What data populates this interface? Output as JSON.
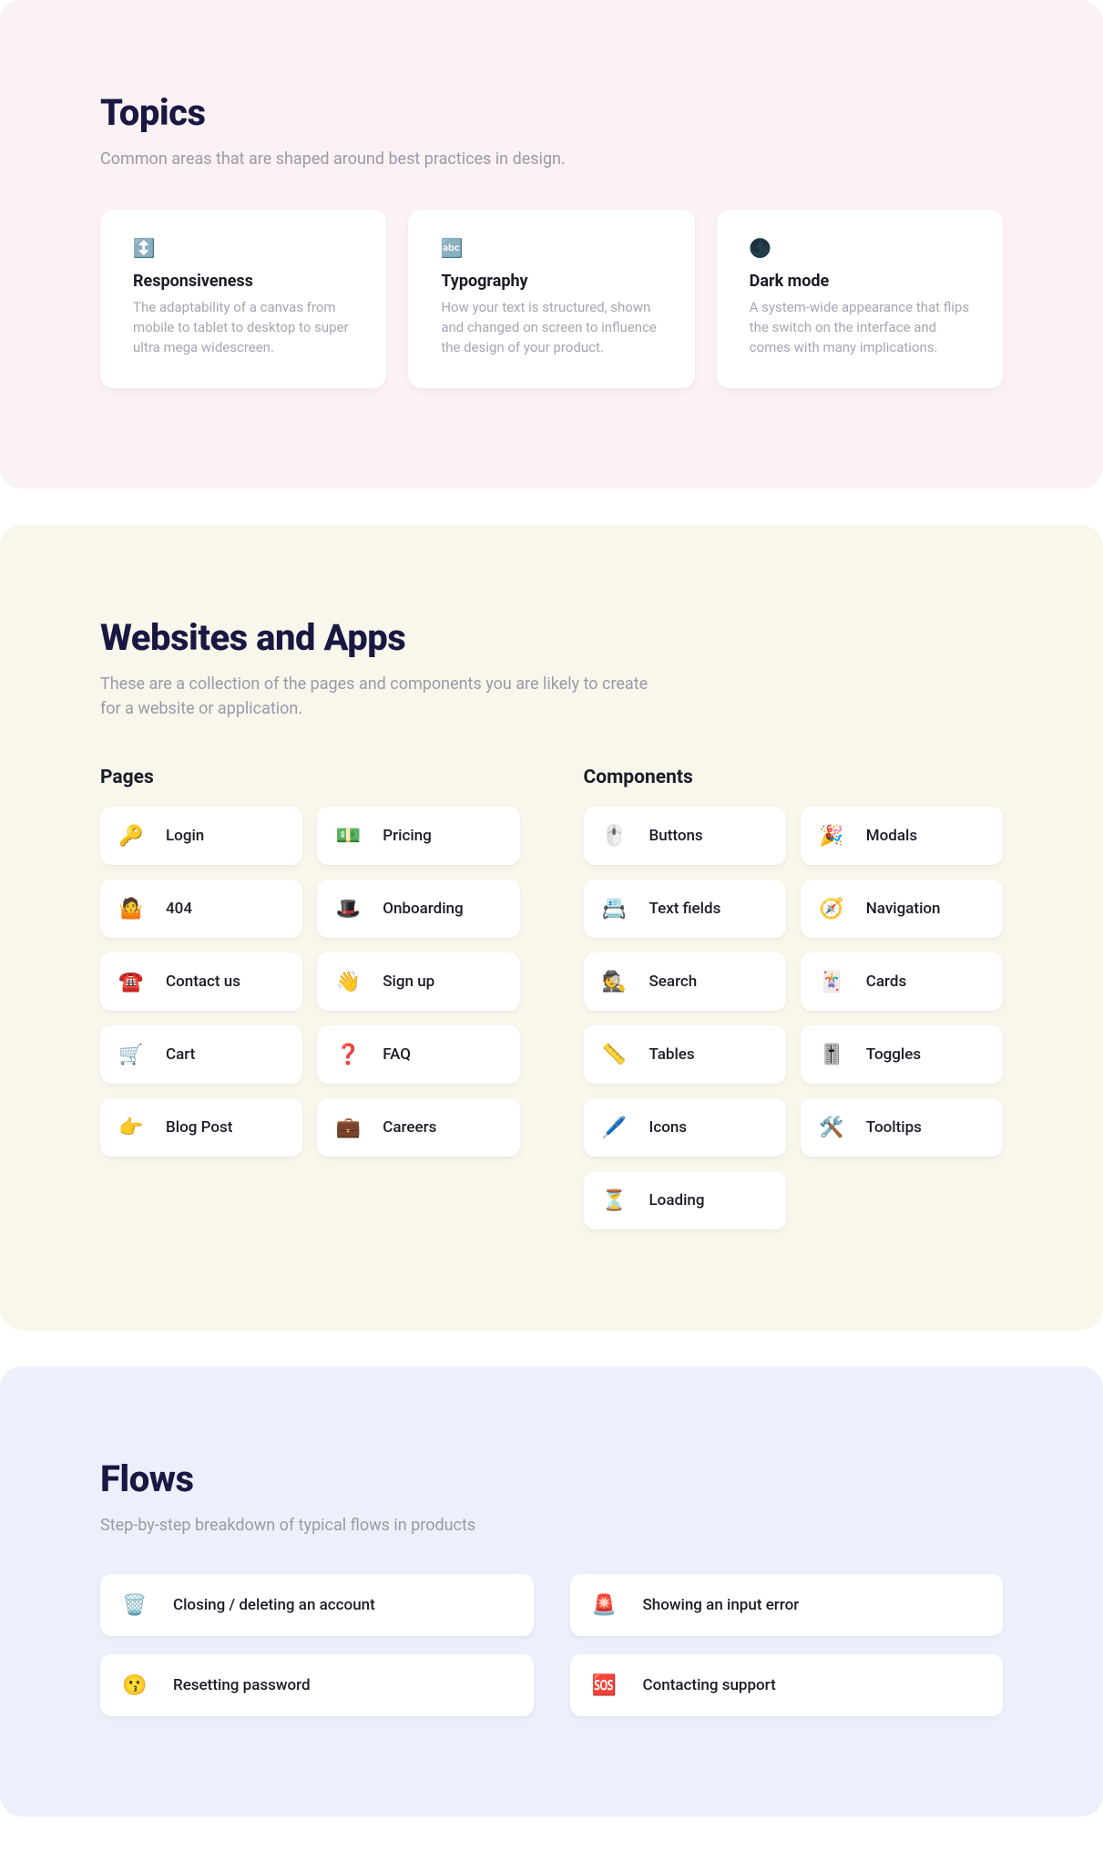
{
  "topics": {
    "heading": "Topics",
    "sub": "Common areas that are shaped around best practices in design.",
    "cards": [
      {
        "icon": "↕️",
        "icon_name": "responsive-icon",
        "title": "Responsiveness",
        "desc": "The adaptability of a canvas from mobile to tablet to desktop to super ultra mega widescreen."
      },
      {
        "icon": "🔤",
        "icon_name": "typography-icon",
        "title": "Typography",
        "desc": "How your text is structured, shown and changed on screen to influence the design of your product."
      },
      {
        "icon": "🌑",
        "icon_name": "darkmode-icon",
        "title": "Dark mode",
        "desc": "A system-wide appearance that flips the switch on the interface and comes with many implications."
      }
    ]
  },
  "web": {
    "heading": "Websites and Apps",
    "sub": "These are a collection of the pages and components you are likely to create for a website or application.",
    "pages_heading": "Pages",
    "components_heading": "Components",
    "pages": [
      {
        "icon": "🔑",
        "icon_name": "key-icon",
        "label": "Login"
      },
      {
        "icon": "💵",
        "icon_name": "money-icon",
        "label": "Pricing"
      },
      {
        "icon": "🤷",
        "icon_name": "shrug-icon",
        "label": "404"
      },
      {
        "icon": "🎩",
        "icon_name": "tophat-icon",
        "label": "Onboarding"
      },
      {
        "icon": "☎️",
        "icon_name": "phone-icon",
        "label": "Contact us"
      },
      {
        "icon": "👋",
        "icon_name": "wave-icon",
        "label": "Sign up"
      },
      {
        "icon": "🛒",
        "icon_name": "cart-icon",
        "label": "Cart"
      },
      {
        "icon": "❓",
        "icon_name": "question-icon",
        "label": "FAQ"
      },
      {
        "icon": "👉",
        "icon_name": "pointing-icon",
        "label": "Blog Post"
      },
      {
        "icon": "💼",
        "icon_name": "briefcase-icon",
        "label": "Careers"
      }
    ],
    "components": [
      {
        "icon": "🖱️",
        "icon_name": "mouse-icon",
        "label": "Buttons"
      },
      {
        "icon": "🎉",
        "icon_name": "party-icon",
        "label": "Modals"
      },
      {
        "icon": "📇",
        "icon_name": "textfield-icon",
        "label": "Text fields"
      },
      {
        "icon": "🧭",
        "icon_name": "compass-icon",
        "label": "Navigation"
      },
      {
        "icon": "🕵️",
        "icon_name": "detective-icon",
        "label": "Search"
      },
      {
        "icon": "🃏",
        "icon_name": "card-icon",
        "label": "Cards"
      },
      {
        "icon": "📏",
        "icon_name": "ruler-icon",
        "label": "Tables"
      },
      {
        "icon": "🎚️",
        "icon_name": "slider-icon",
        "label": "Toggles"
      },
      {
        "icon": "🖊️",
        "icon_name": "pen-icon",
        "label": "Icons"
      },
      {
        "icon": "🛠️",
        "icon_name": "tools-icon",
        "label": "Tooltips"
      },
      {
        "icon": "⏳",
        "icon_name": "hourglass-icon",
        "label": "Loading"
      }
    ]
  },
  "flows": {
    "heading": "Flows",
    "sub": "Step-by-step breakdown of typical flows in products",
    "items": [
      {
        "icon": "🗑️",
        "icon_name": "trash-icon",
        "label": "Closing / deleting an account"
      },
      {
        "icon": "🚨",
        "icon_name": "alarm-icon",
        "label": "Showing an input error"
      },
      {
        "icon": "😗",
        "icon_name": "face-icon",
        "label": "Resetting password"
      },
      {
        "icon": "🆘",
        "icon_name": "sos-icon",
        "label": "Contacting support"
      }
    ]
  }
}
